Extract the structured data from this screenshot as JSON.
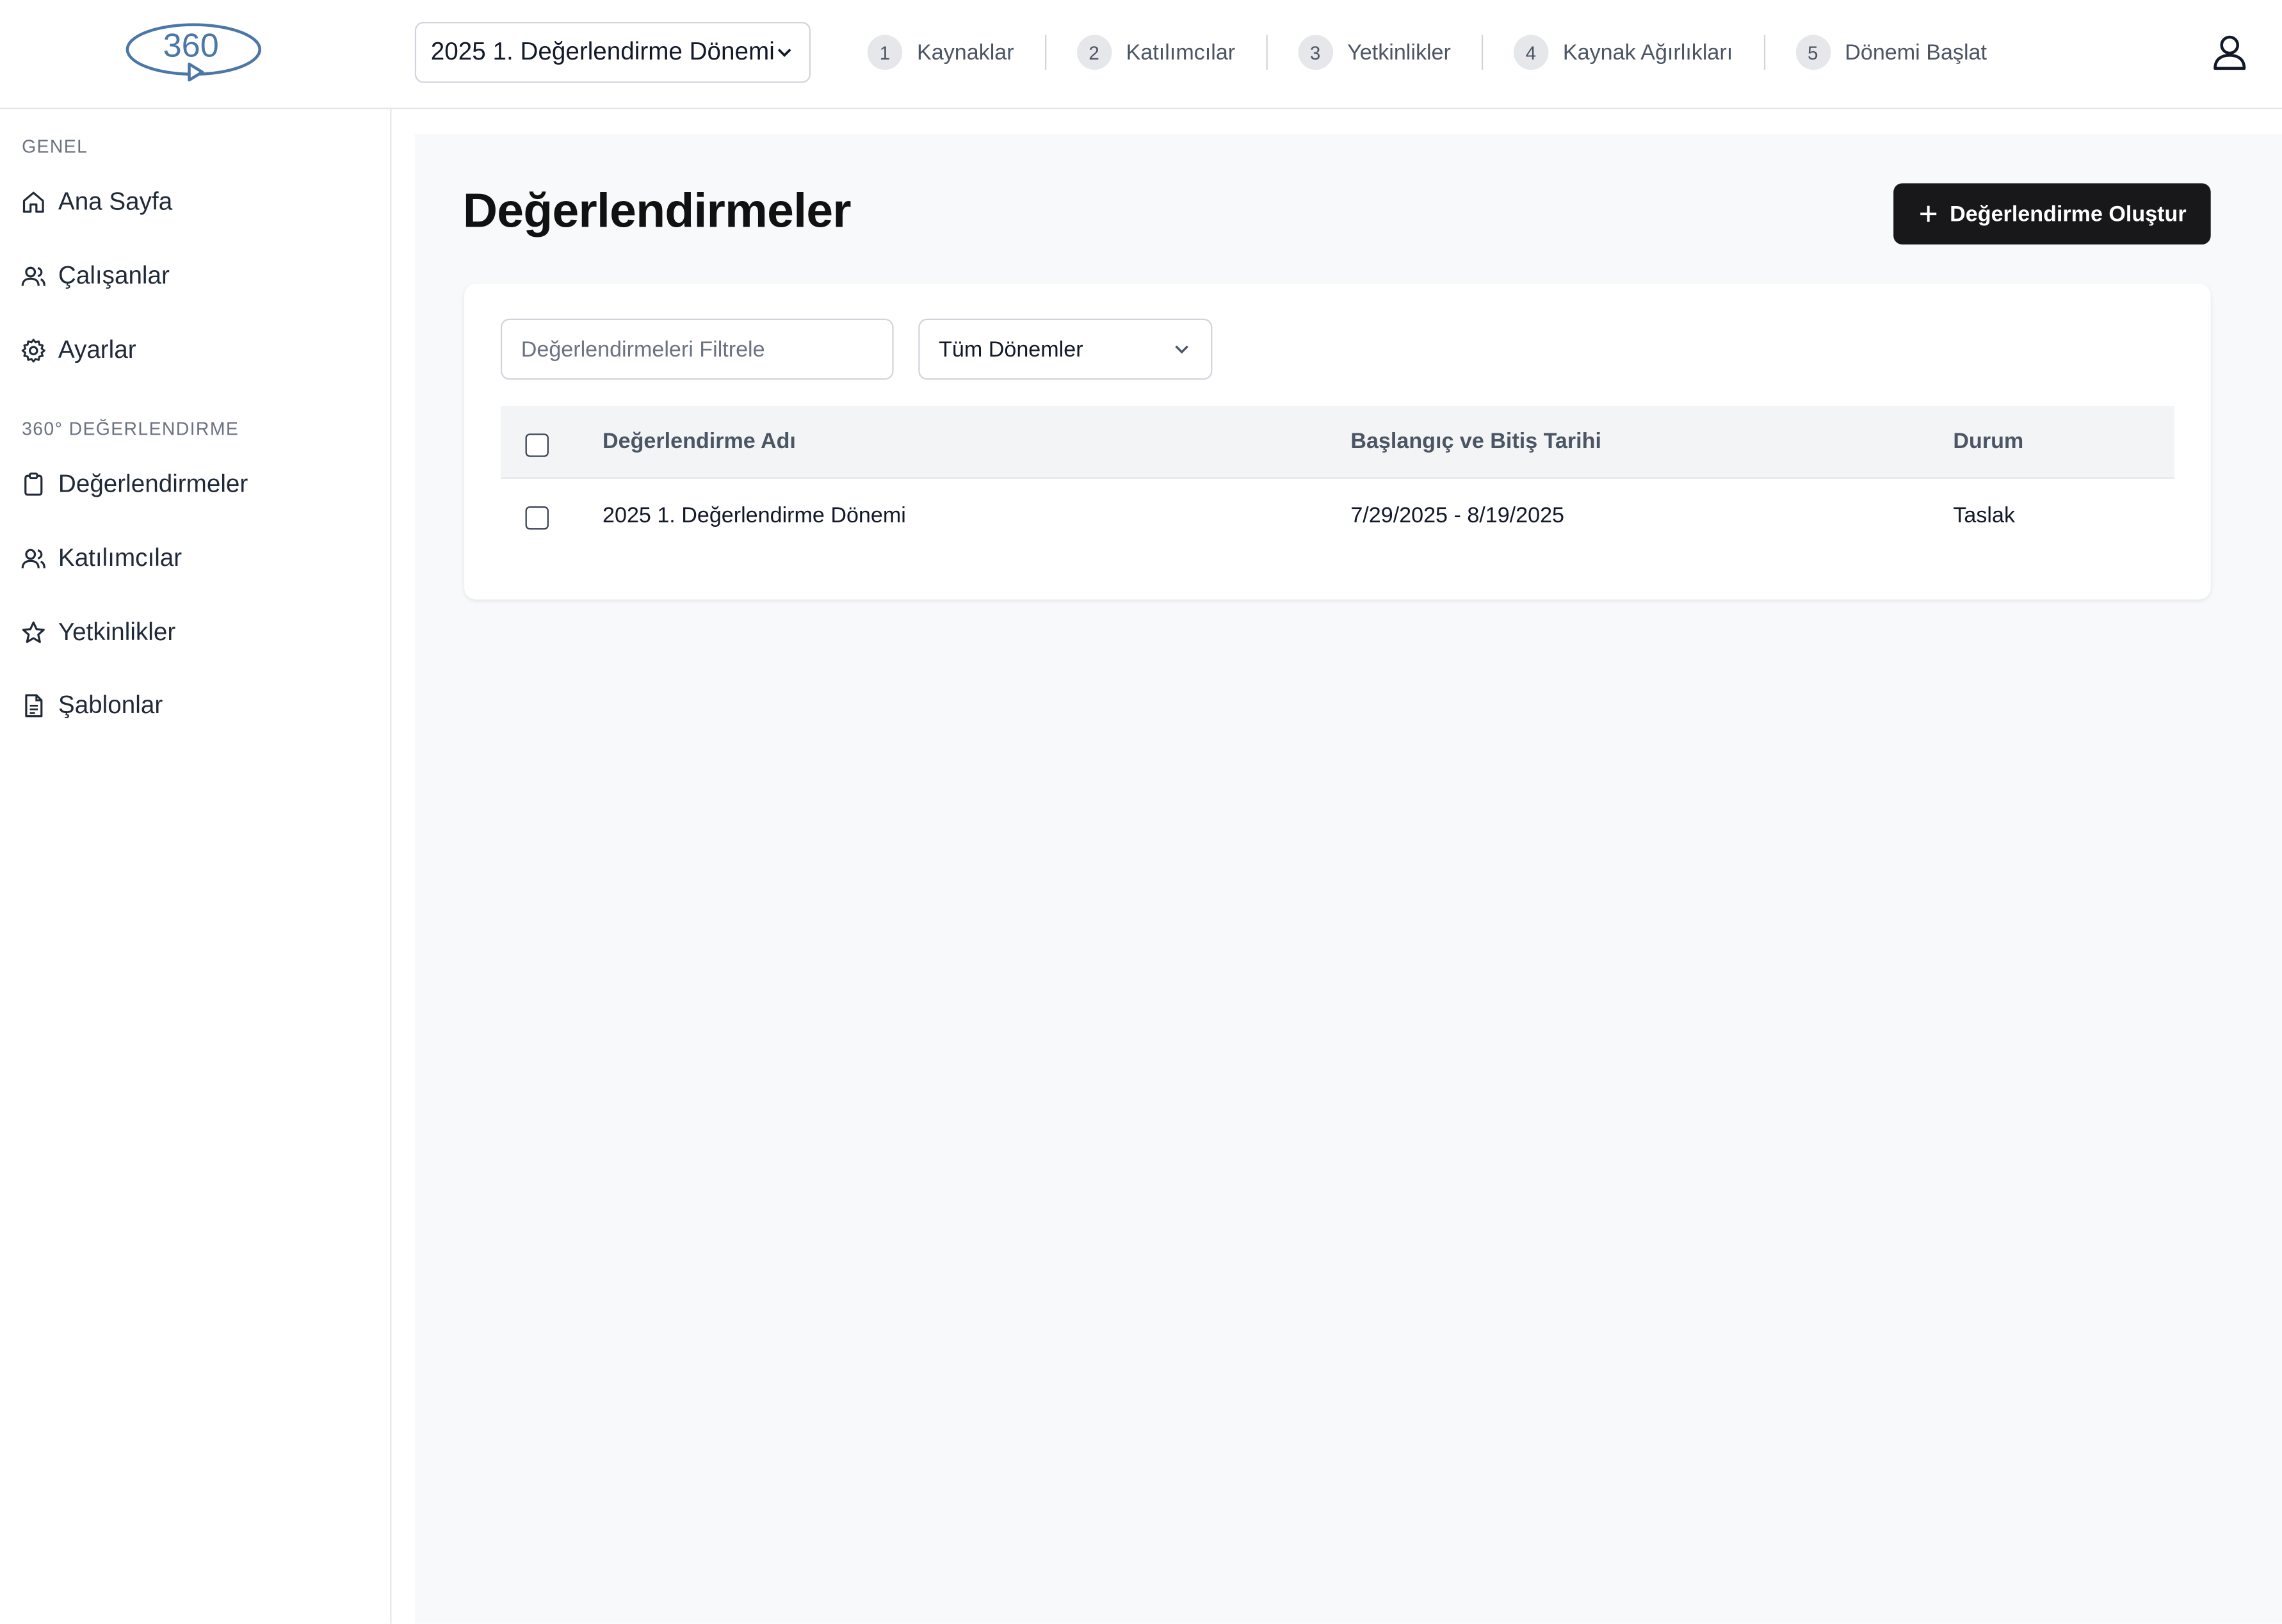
{
  "header": {
    "period_selector": "2025 1. Değerlendirme Dönemi",
    "steps": [
      {
        "number": "1",
        "label": "Kaynaklar"
      },
      {
        "number": "2",
        "label": "Katılımcılar"
      },
      {
        "number": "3",
        "label": "Yetkinlikler"
      },
      {
        "number": "4",
        "label": "Kaynak Ağırlıkları"
      },
      {
        "number": "5",
        "label": "Dönemi Başlat"
      }
    ]
  },
  "sidebar": {
    "sections": [
      {
        "title": "GENEL",
        "items": [
          {
            "label": "Ana Sayfa",
            "icon": "home-icon"
          },
          {
            "label": "Çalışanlar",
            "icon": "users-icon"
          },
          {
            "label": "Ayarlar",
            "icon": "gear-icon"
          }
        ]
      },
      {
        "title": "360° DEĞERLENDIRME",
        "items": [
          {
            "label": "Değerlendirmeler",
            "icon": "clipboard-icon"
          },
          {
            "label": "Katılımcılar",
            "icon": "users-icon"
          },
          {
            "label": "Yetkinlikler",
            "icon": "star-icon"
          },
          {
            "label": "Şablonlar",
            "icon": "document-icon"
          }
        ]
      }
    ]
  },
  "main": {
    "title": "Değerlendirmeler",
    "create_button": "Değerlendirme Oluştur",
    "filter": {
      "placeholder": "Değerlendirmeleri Filtrele",
      "value": ""
    },
    "period_filter": "Tüm Dönemler",
    "table": {
      "columns": [
        "Değerlendirme Adı",
        "Başlangıç ve Bitiş Tarihi",
        "Durum"
      ],
      "rows": [
        {
          "name": "2025 1. Değerlendirme Dönemi",
          "dates": "7/29/2025 - 8/19/2025",
          "status": "Taslak",
          "selected": false
        }
      ]
    }
  },
  "colors": {
    "primary_button": "#18181b",
    "main_background": "#f8f9fa",
    "logo": "#4a76a8"
  }
}
